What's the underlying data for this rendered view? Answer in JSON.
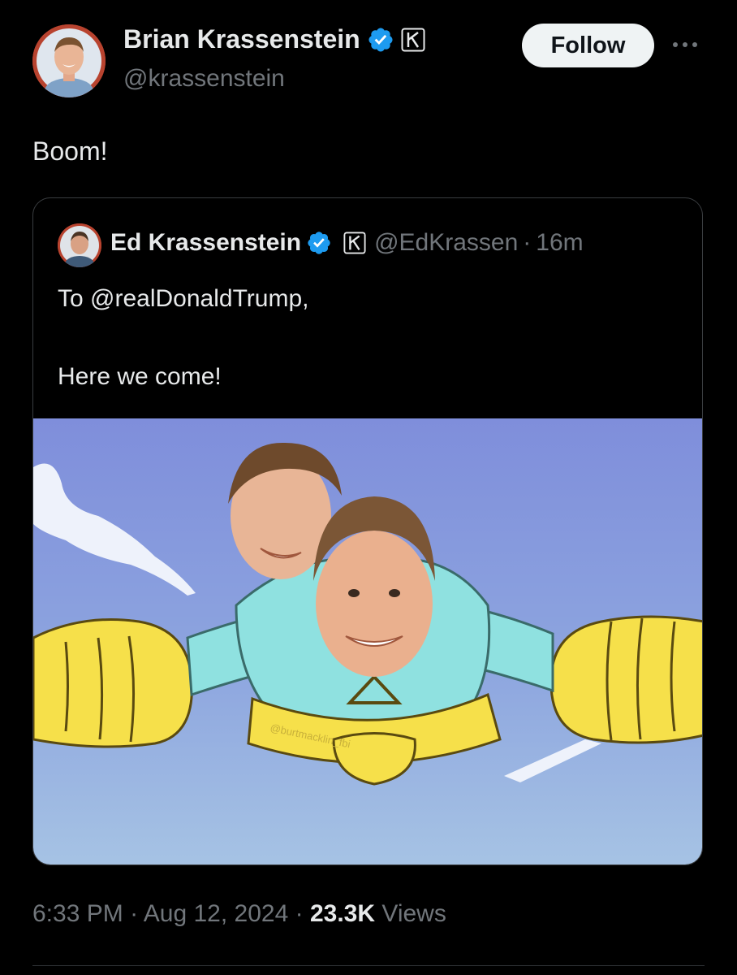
{
  "tweet": {
    "author_name": "Brian Krassenstein",
    "author_handle": "@krassenstein",
    "follow_label": "Follow",
    "text": "Boom!",
    "time": "6:33 PM",
    "date": "Aug 12, 2024",
    "views_count": "23.3K",
    "views_label": "Views",
    "separator": "·"
  },
  "quoted": {
    "author_name": "Ed Krassenstein",
    "author_handle": "@EdKrassen",
    "time": "16m",
    "separator": "·",
    "text_line1": "To @realDonaldTrump,",
    "text_line2": "Here we come!",
    "image_watermark": "@burtmacklin_fbi"
  },
  "colors": {
    "background": "#000000",
    "text": "#e7e9ea",
    "muted": "#71767b",
    "verified": "#1d9bf0",
    "sky": "#8e9ed9"
  },
  "icons": {
    "verified": "verified-badge-icon",
    "affiliate": "k-affiliate-icon",
    "more": "more-options-icon"
  }
}
